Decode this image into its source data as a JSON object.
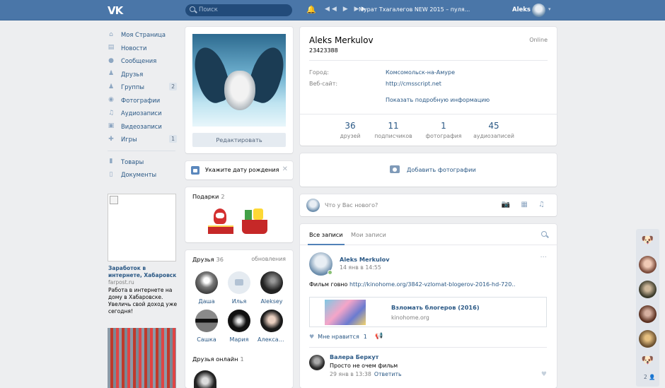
{
  "topbar": {
    "logo": "VK",
    "search_placeholder": "Поиск",
    "player_controls": "◀◀ ▶ ▶▶",
    "track": "Мурат Тхагалегов NEW 2015 – пуля...",
    "username": "Aleks",
    "arrow": "▾"
  },
  "nav": {
    "items": [
      {
        "label": "Моя Страница",
        "icon": "home-icon"
      },
      {
        "label": "Новости",
        "icon": "news-icon"
      },
      {
        "label": "Сообщения",
        "icon": "messages-icon"
      },
      {
        "label": "Друзья",
        "icon": "friends-icon"
      },
      {
        "label": "Группы",
        "icon": "groups-icon",
        "badge": "2"
      },
      {
        "label": "Фотографии",
        "icon": "camera-icon"
      },
      {
        "label": "Аудиозаписи",
        "icon": "music-icon"
      },
      {
        "label": "Видеозаписи",
        "icon": "video-icon"
      },
      {
        "label": "Игры",
        "icon": "games-icon",
        "badge": "1"
      }
    ],
    "extra": [
      {
        "label": "Товары",
        "icon": "bag-icon"
      },
      {
        "label": "Документы",
        "icon": "document-icon"
      }
    ]
  },
  "ad": {
    "title": "Заработок в интернете, Хабаровск",
    "source": "farpost.ru",
    "text": "Работа в интернете на дому в Хабаровске. Увеличь свой доход уже сегодня!"
  },
  "avatar_card": {
    "edit_button": "Редактировать"
  },
  "birthday": {
    "text": "Укажите дату рождения",
    "close": "✕"
  },
  "gifts": {
    "title": "Подарки",
    "count": "2"
  },
  "friends": {
    "title": "Друзья",
    "count": "36",
    "updates": "обновления",
    "list": [
      {
        "name": "Даша"
      },
      {
        "name": "Илья"
      },
      {
        "name": "Aleksey"
      },
      {
        "name": "Сашка"
      },
      {
        "name": "Мария"
      },
      {
        "name": "Александ..."
      }
    ],
    "online_title": "Друзья онлайн",
    "online_count": "1"
  },
  "profile": {
    "name": "Aleks Merkulov",
    "id": "23423388",
    "status": "Online",
    "city_label": "Город:",
    "city": "Комсомольск-на-Амуре",
    "site_label": "Веб-сайт:",
    "site": "http://cmsscript.net",
    "more": "Показать подробную информацию",
    "counters": [
      {
        "value": "36",
        "label": "друзей"
      },
      {
        "value": "11",
        "label": "подписчиков"
      },
      {
        "value": "1",
        "label": "фотография"
      },
      {
        "value": "45",
        "label": "аудиозаписей"
      }
    ]
  },
  "add_photo": {
    "label": "Добавить фотографии"
  },
  "new_post": {
    "placeholder": "Что у Вас нового?",
    "icons": "📷 ▦ ♫"
  },
  "wall": {
    "tab_all": "Все записи",
    "tab_mine": "Мои записи",
    "post": {
      "author": "Aleks Merkulov",
      "date": "14 янв в 14:55",
      "text": "Фильм говно",
      "link": "http://kinohome.org/3842-vzlomat-blogerov-2016-hd-720..",
      "card_title": "Взломать блогеров (2016)",
      "card_source": "kinohome.org",
      "like_label": "Мне нравится",
      "like_count": "1",
      "dots": "···"
    },
    "comment": {
      "author": "Валера Беркут",
      "text": "Просто не очем фильм",
      "date": "29 янв в 13:38",
      "reply": "Ответить"
    }
  },
  "rightbar": {
    "count": "2 👤"
  }
}
